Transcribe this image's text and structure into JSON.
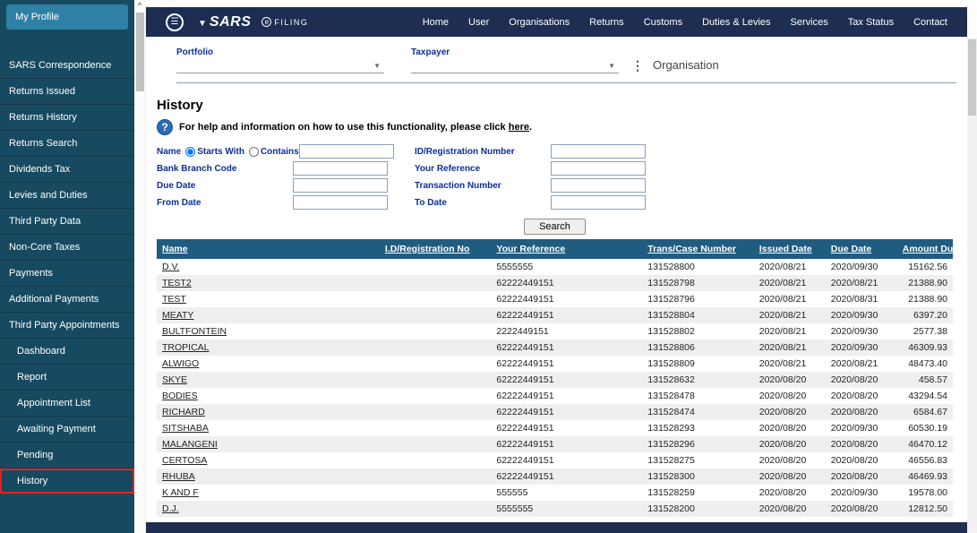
{
  "sidebar": {
    "profile_label": "My Profile",
    "items": [
      {
        "label": "SARS Correspondence",
        "indent": false,
        "selected": false
      },
      {
        "label": "Returns Issued",
        "indent": false,
        "selected": false
      },
      {
        "label": "Returns History",
        "indent": false,
        "selected": false
      },
      {
        "label": "Returns Search",
        "indent": false,
        "selected": false
      },
      {
        "label": "Dividends Tax",
        "indent": false,
        "selected": false
      },
      {
        "label": "Levies and Duties",
        "indent": false,
        "selected": false
      },
      {
        "label": "Third Party Data",
        "indent": false,
        "selected": false
      },
      {
        "label": "Non-Core Taxes",
        "indent": false,
        "selected": false
      },
      {
        "label": "Payments",
        "indent": false,
        "selected": false
      },
      {
        "label": "Additional Payments",
        "indent": false,
        "selected": false
      },
      {
        "label": "Third Party Appointments",
        "indent": false,
        "selected": false
      },
      {
        "label": "Dashboard",
        "indent": true,
        "selected": false
      },
      {
        "label": "Report",
        "indent": true,
        "selected": false
      },
      {
        "label": "Appointment List",
        "indent": true,
        "selected": false
      },
      {
        "label": "Awaiting Payment",
        "indent": true,
        "selected": false
      },
      {
        "label": "Pending",
        "indent": true,
        "selected": false
      },
      {
        "label": "History",
        "indent": true,
        "selected": true
      }
    ]
  },
  "header": {
    "brand": "SARS",
    "brand_sub": "FILING",
    "nav": [
      "Home",
      "User",
      "Organisations",
      "Returns",
      "Customs",
      "Duties & Levies",
      "Services",
      "Tax Status",
      "Contact"
    ]
  },
  "portfolio_bar": {
    "portfolio_label": "Portfolio",
    "taxpayer_label": "Taxpayer",
    "organisation_label": "Organisation"
  },
  "content": {
    "title": "History",
    "help": {
      "text": "For help and information on how to use this functionality, please click",
      "link": "here",
      "suffix": "."
    },
    "form": {
      "name_label": "Name",
      "starts_with_label": "Starts With",
      "contains_label": "Contains",
      "id_registration_label": "ID/Registration Number",
      "bank_branch_label": "Bank Branch Code",
      "your_reference_label": "Your Reference",
      "due_date_label": "Due Date",
      "transaction_number_label": "Transaction Number",
      "from_date_label": "From Date",
      "to_date_label": "To Date",
      "search_button_label": "Search"
    },
    "table": {
      "headers": [
        "Name",
        "I.D/Registration No",
        "Your Reference",
        "Trans/Case Number",
        "Issued Date",
        "Due Date",
        "Amount Due"
      ],
      "rows": [
        {
          "name": "D.V.",
          "id_reg": "",
          "your_ref": "5555555",
          "trans_case": "131528800",
          "issued": "2020/08/21",
          "due": "2020/09/30",
          "amount": "15162.56"
        },
        {
          "name": "TEST2",
          "id_reg": "",
          "your_ref": "62222449151",
          "trans_case": "131528798",
          "issued": "2020/08/21",
          "due": "2020/08/21",
          "amount": "21388.90"
        },
        {
          "name": "TEST",
          "id_reg": "",
          "your_ref": "62222449151",
          "trans_case": "131528796",
          "issued": "2020/08/21",
          "due": "2020/08/31",
          "amount": "21388.90"
        },
        {
          "name": "MEATY",
          "id_reg": "",
          "your_ref": "62222449151",
          "trans_case": "131528804",
          "issued": "2020/08/21",
          "due": "2020/09/30",
          "amount": "6397.20"
        },
        {
          "name": "BULTFONTEIN",
          "id_reg": "",
          "your_ref": "2222449151",
          "trans_case": "131528802",
          "issued": "2020/08/21",
          "due": "2020/09/30",
          "amount": "2577.38"
        },
        {
          "name": "TROPICAL",
          "id_reg": "",
          "your_ref": "62222449151",
          "trans_case": "131528806",
          "issued": "2020/08/21",
          "due": "2020/09/30",
          "amount": "46309.93"
        },
        {
          "name": "ALWIGO",
          "id_reg": "",
          "your_ref": "62222449151",
          "trans_case": "131528809",
          "issued": "2020/08/21",
          "due": "2020/08/21",
          "amount": "48473.40"
        },
        {
          "name": "SKYE",
          "id_reg": "",
          "your_ref": "62222449151",
          "trans_case": "131528632",
          "issued": "2020/08/20",
          "due": "2020/08/20",
          "amount": "458.57"
        },
        {
          "name": "BODIES",
          "id_reg": "",
          "your_ref": "62222449151",
          "trans_case": "131528478",
          "issued": "2020/08/20",
          "due": "2020/08/20",
          "amount": "43294.54"
        },
        {
          "name": "RICHARD",
          "id_reg": "",
          "your_ref": "62222449151",
          "trans_case": "131528474",
          "issued": "2020/08/20",
          "due": "2020/08/20",
          "amount": "6584.67"
        },
        {
          "name": "SITSHABA",
          "id_reg": "",
          "your_ref": "62222449151",
          "trans_case": "131528293",
          "issued": "2020/08/20",
          "due": "2020/09/30",
          "amount": "60530.19"
        },
        {
          "name": "MALANGENI",
          "id_reg": "",
          "your_ref": "62222449151",
          "trans_case": "131528296",
          "issued": "2020/08/20",
          "due": "2020/08/20",
          "amount": "46470.12"
        },
        {
          "name": "CERTOSA",
          "id_reg": "",
          "your_ref": "62222449151",
          "trans_case": "131528275",
          "issued": "2020/08/20",
          "due": "2020/08/20",
          "amount": "46556.83"
        },
        {
          "name": "RHUBA",
          "id_reg": "",
          "your_ref": "62222449151",
          "trans_case": "131528300",
          "issued": "2020/08/20",
          "due": "2020/08/20",
          "amount": "46469.93"
        },
        {
          "name": "K AND F",
          "id_reg": "",
          "your_ref": "555555",
          "trans_case": "131528259",
          "issued": "2020/08/20",
          "due": "2020/09/30",
          "amount": "19578.00"
        },
        {
          "name": "D.J.",
          "id_reg": "",
          "your_ref": "5555555",
          "trans_case": "131528200",
          "issued": "2020/08/20",
          "due": "2020/08/20",
          "amount": "12812.50"
        }
      ]
    }
  },
  "colors": {
    "sidebar_bg": "#174A60",
    "profile_button_bg": "#2E81A5",
    "topbar_bg": "#1D2E52",
    "table_header_bg": "#1F5C80",
    "label_blue": "#0B2F96",
    "highlight_red": "#E8201F"
  }
}
